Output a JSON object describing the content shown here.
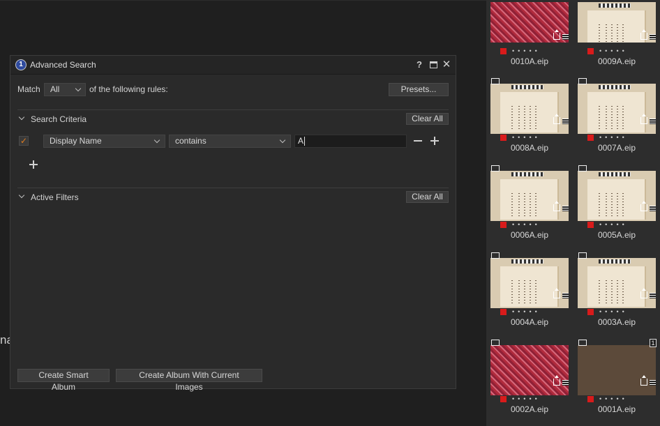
{
  "background": {
    "fragment_text": "na"
  },
  "dialog": {
    "title": "Advanced Search",
    "help_label": "?",
    "match": {
      "label": "Match",
      "selected": "All",
      "rest": "of the following rules:"
    },
    "presets_label": "Presets...",
    "search_criteria": {
      "title": "Search Criteria",
      "clear_label": "Clear All",
      "rule": {
        "field": "Display Name",
        "operator": "contains",
        "value": "A"
      }
    },
    "active_filters": {
      "title": "Active Filters",
      "clear_label": "Clear All"
    },
    "buttons": {
      "create_smart_album": "Create Smart Album",
      "create_album_current": "Create Album With Current Images"
    }
  },
  "thumbnails": [
    {
      "name": "0010A.eip",
      "style": "pattern"
    },
    {
      "name": "0009A.eip",
      "style": "paper"
    },
    {
      "name": "0008A.eip",
      "style": "paper"
    },
    {
      "name": "0007A.eip",
      "style": "paper"
    },
    {
      "name": "0006A.eip",
      "style": "paper"
    },
    {
      "name": "0005A.eip",
      "style": "paper"
    },
    {
      "name": "0004A.eip",
      "style": "paper"
    },
    {
      "name": "0003A.eip",
      "style": "paper"
    },
    {
      "name": "0002A.eip",
      "style": "pattern"
    },
    {
      "name": "0001A.eip",
      "style": "leather",
      "badge": "1"
    }
  ],
  "colors": {
    "accent_check": "#e07d1f",
    "color_label": "#d81b1b"
  }
}
